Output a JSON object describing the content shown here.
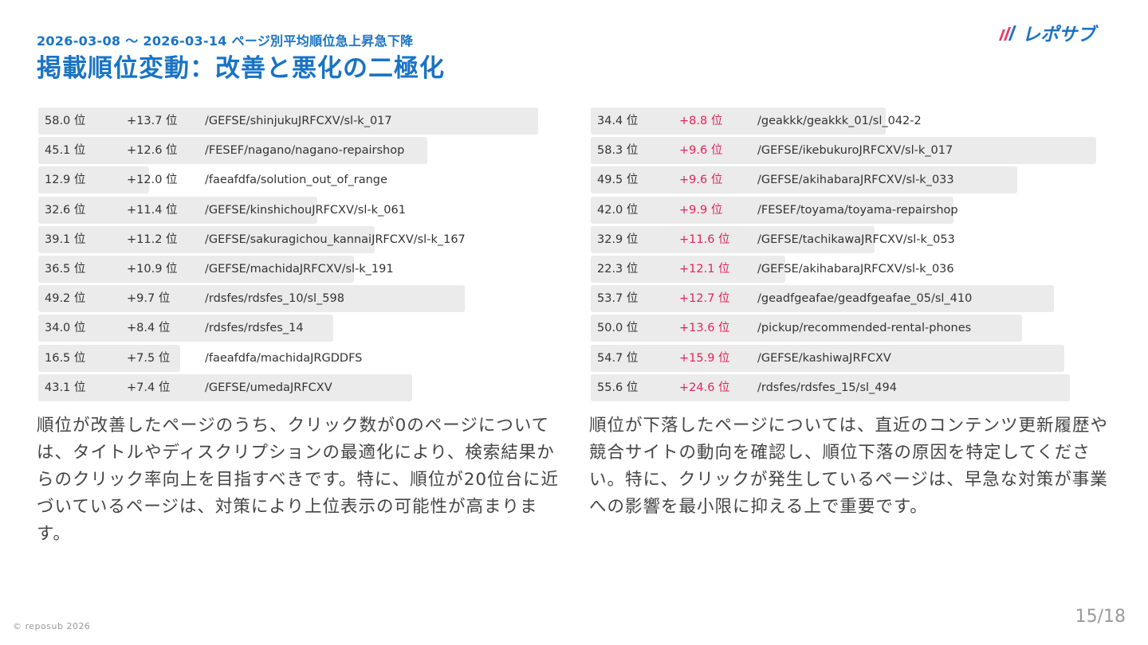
{
  "header": {
    "subtitle": "2026-03-08 ～ 2026-03-14 ページ別平均順位急上昇急下降",
    "title": "掲載順位変動：改善と悪化の二極化",
    "logo_text": "レポサブ"
  },
  "improved": {
    "rows": [
      {
        "rank": "58.0 位",
        "delta": "+13.7 位",
        "path": "/GEFSE/shinjukuJRFCXV/sl-k_017",
        "fill": 0.95
      },
      {
        "rank": "45.1 位",
        "delta": "+12.6 位",
        "path": "/FESEF/nagano/nagano-repairshop",
        "fill": 0.74
      },
      {
        "rank": "12.9 位",
        "delta": "+12.0 位",
        "path": "/faeafdfa/solution_out_of_range",
        "fill": 0.21
      },
      {
        "rank": "32.6 位",
        "delta": "+11.4 位",
        "path": "/GEFSE/kinshichouJRFCXV/sl-k_061",
        "fill": 0.53
      },
      {
        "rank": "39.1 位",
        "delta": "+11.2 位",
        "path": "/GEFSE/sakuragichou_kannaiJRFCXV/sl-k_167",
        "fill": 0.64
      },
      {
        "rank": "36.5 位",
        "delta": "+10.9 位",
        "path": "/GEFSE/machidaJRFCXV/sl-k_191",
        "fill": 0.6
      },
      {
        "rank": "49.2 位",
        "delta": "+9.7 位",
        "path": "/rdsfes/rdsfes_10/sl_598",
        "fill": 0.81
      },
      {
        "rank": "34.0 位",
        "delta": "+8.4 位",
        "path": "/rdsfes/rdsfes_14",
        "fill": 0.56
      },
      {
        "rank": "16.5 位",
        "delta": "+7.5 位",
        "path": "/faeafdfa/machidaJRGDDFS",
        "fill": 0.27
      },
      {
        "rank": "43.1 位",
        "delta": "+7.4 位",
        "path": "/GEFSE/umedaJRFCXV",
        "fill": 0.71
      }
    ],
    "note": "順位が改善したページのうち、クリック数が0のページについては、タイトルやディスクリプションの最適化により、検索結果からのクリック率向上を目指すべきです。特に、順位が20位台に近づいているページは、対策により上位表示の可能性が高まります。"
  },
  "declined": {
    "rows": [
      {
        "rank": "34.4 位",
        "delta": "+8.8 位",
        "path": "/geakkk/geakkk_01/sl_042-2",
        "fill": 0.56
      },
      {
        "rank": "58.3 位",
        "delta": "+9.6 位",
        "path": "/GEFSE/ikebukuroJRFCXV/sl-k_017",
        "fill": 0.96
      },
      {
        "rank": "49.5 位",
        "delta": "+9.6 位",
        "path": "/GEFSE/akihabaraJRFCXV/sl-k_033",
        "fill": 0.81
      },
      {
        "rank": "42.0 位",
        "delta": "+9.9 位",
        "path": "/FESEF/toyama/toyama-repairshop",
        "fill": 0.69
      },
      {
        "rank": "32.9 位",
        "delta": "+11.6 位",
        "path": "/GEFSE/tachikawaJRFCXV/sl-k_053",
        "fill": 0.54
      },
      {
        "rank": "22.3 位",
        "delta": "+12.1 位",
        "path": "/GEFSE/akihabaraJRFCXV/sl-k_036",
        "fill": 0.37
      },
      {
        "rank": "53.7 位",
        "delta": "+12.7 位",
        "path": "/geadfgeafae/geadfgeafae_05/sl_410",
        "fill": 0.88
      },
      {
        "rank": "50.0 位",
        "delta": "+13.6 位",
        "path": "/pickup/recommended-rental-phones",
        "fill": 0.82
      },
      {
        "rank": "54.7 位",
        "delta": "+15.9 位",
        "path": "/GEFSE/kashiwaJRFCXV",
        "fill": 0.9
      },
      {
        "rank": "55.6 位",
        "delta": "+24.6 位",
        "path": "/rdsfes/rdsfes_15/sl_494",
        "fill": 0.91
      }
    ],
    "note": "順位が下落したページについては、直近のコンテンツ更新履歴や競合サイトの動向を確認し、順位下落の原因を特定してください。特に、クリックが発生しているページは、早急な対策が事業への影響を最小限に抑える上で重要です。"
  },
  "footer": {
    "copyright": "© reposub 2026",
    "page": "15/18"
  },
  "colors": {
    "accent": "#1a73c4",
    "decline": "#e0245e",
    "logo_stripes": [
      "#e83e6b",
      "#1a73c4"
    ]
  }
}
